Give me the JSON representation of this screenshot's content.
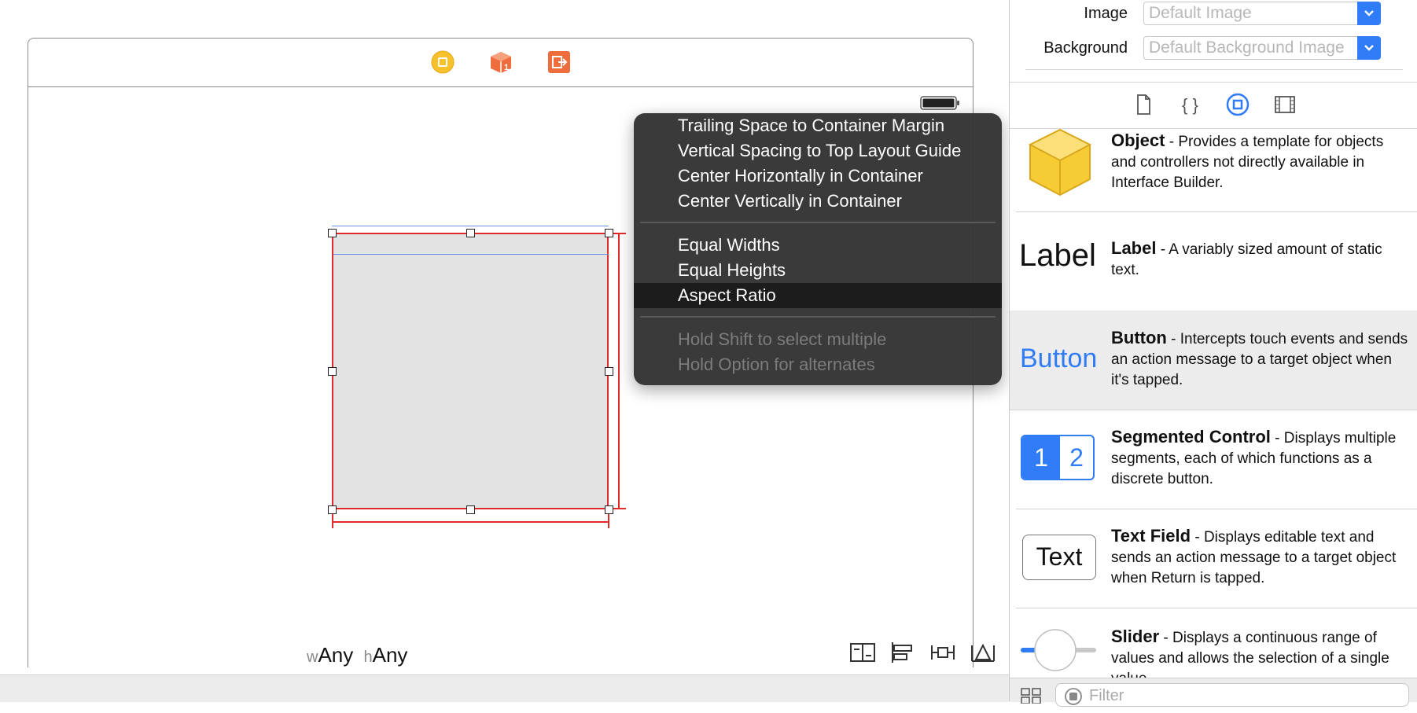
{
  "canvas": {
    "size_class": {
      "w_prefix": "w",
      "w_value": "Any",
      "h_prefix": "h",
      "h_value": "Any"
    },
    "dock_icons": [
      "view-controller-icon",
      "first-responder-icon",
      "exit-icon"
    ],
    "layout_buttons": [
      "stack-icon",
      "align-icon",
      "pin-icon",
      "resolve-issues-icon"
    ]
  },
  "context_menu": {
    "items": [
      {
        "label": "Trailing Space to Container Margin",
        "enabled": true
      },
      {
        "label": "Vertical Spacing to Top Layout Guide",
        "enabled": true
      },
      {
        "label": "Center Horizontally in Container",
        "enabled": true
      },
      {
        "label": "Center Vertically in Container",
        "enabled": true
      },
      {
        "label": "Equal Widths",
        "enabled": true
      },
      {
        "label": "Equal Heights",
        "enabled": true
      },
      {
        "label": "Aspect Ratio",
        "enabled": true,
        "highlighted": true
      },
      {
        "label": "Hold Shift to select multiple",
        "enabled": false
      },
      {
        "label": "Hold Option for alternates",
        "enabled": false
      }
    ]
  },
  "inspector": {
    "image": {
      "label": "Image",
      "placeholder": "Default Image"
    },
    "background": {
      "label": "Background",
      "placeholder": "Default Background Image"
    }
  },
  "library_tabs": [
    "file-template-icon",
    "code-snippet-icon",
    "object-library-icon",
    "media-library-icon"
  ],
  "library": [
    {
      "name": "Object",
      "desc": " - Provides a template for objects and controllers not directly available in Interface Builder.",
      "thumb": "cube-icon"
    },
    {
      "name": "Label",
      "desc": " - A variably sized amount of static text.",
      "thumb_text": "Label"
    },
    {
      "name": "Button",
      "desc": " - Intercepts touch events and sends an action message to a target object when it's tapped.",
      "thumb_text": "Button"
    },
    {
      "name": "Segmented Control",
      "desc": " - Displays multiple segments, each of which functions as a discrete button.",
      "thumb_segments": [
        "1",
        "2"
      ]
    },
    {
      "name": "Text Field",
      "desc": " - Displays editable text and sends an action message to a target object when Return is tapped.",
      "thumb_text": "Text"
    },
    {
      "name": "Slider",
      "desc": " - Displays a continuous range of values and allows the selection of a single value.",
      "thumb": "slider-icon"
    }
  ],
  "filter": {
    "placeholder": "Filter"
  },
  "colors": {
    "accent": "#2f7cf6",
    "constraint_red": "#e12b2b",
    "guide_blue": "#6b8fe6"
  }
}
